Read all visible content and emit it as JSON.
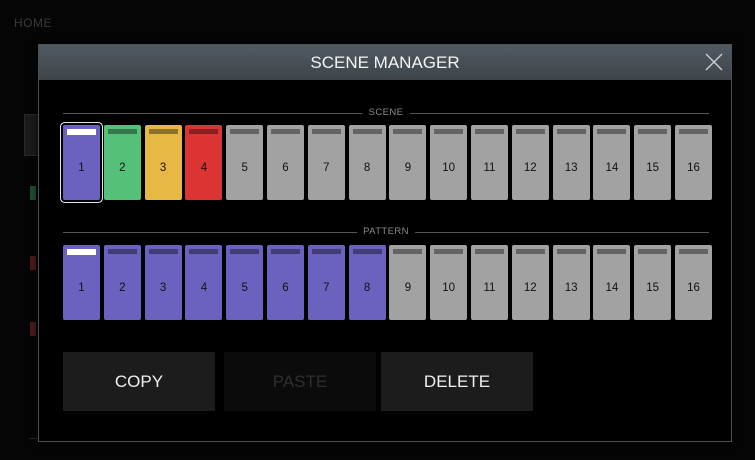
{
  "background": {
    "home_label": "HOME"
  },
  "modal": {
    "title": "SCENE MANAGER",
    "close_icon": "close-icon"
  },
  "scene": {
    "label": "SCENE",
    "selected": 1,
    "pads": [
      {
        "label": "1",
        "color": "#6b62bf",
        "selected": true
      },
      {
        "label": "2",
        "color": "#55c078"
      },
      {
        "label": "3",
        "color": "#e7b844"
      },
      {
        "label": "4",
        "color": "#dc3432"
      },
      {
        "label": "5",
        "color": "#a2a2a2"
      },
      {
        "label": "6",
        "color": "#a2a2a2"
      },
      {
        "label": "7",
        "color": "#a2a2a2"
      },
      {
        "label": "8",
        "color": "#a2a2a2"
      },
      {
        "label": "9",
        "color": "#a2a2a2"
      },
      {
        "label": "10",
        "color": "#a2a2a2"
      },
      {
        "label": "11",
        "color": "#a2a2a2"
      },
      {
        "label": "12",
        "color": "#a2a2a2"
      },
      {
        "label": "13",
        "color": "#a2a2a2"
      },
      {
        "label": "14",
        "color": "#a2a2a2"
      },
      {
        "label": "15",
        "color": "#a2a2a2"
      },
      {
        "label": "16",
        "color": "#a2a2a2"
      }
    ]
  },
  "pattern": {
    "label": "PATTERN",
    "pads": [
      {
        "label": "1",
        "color": "#6b62bf",
        "selected": true
      },
      {
        "label": "2",
        "color": "#6b62bf"
      },
      {
        "label": "3",
        "color": "#6b62bf"
      },
      {
        "label": "4",
        "color": "#6b62bf"
      },
      {
        "label": "5",
        "color": "#6b62bf"
      },
      {
        "label": "6",
        "color": "#6b62bf"
      },
      {
        "label": "7",
        "color": "#6b62bf"
      },
      {
        "label": "8",
        "color": "#6b62bf"
      },
      {
        "label": "9",
        "color": "#a2a2a2"
      },
      {
        "label": "10",
        "color": "#a2a2a2"
      },
      {
        "label": "11",
        "color": "#a2a2a2"
      },
      {
        "label": "12",
        "color": "#a2a2a2"
      },
      {
        "label": "13",
        "color": "#a2a2a2"
      },
      {
        "label": "14",
        "color": "#a2a2a2"
      },
      {
        "label": "15",
        "color": "#a2a2a2"
      },
      {
        "label": "16",
        "color": "#a2a2a2"
      }
    ]
  },
  "actions": {
    "copy": "COPY",
    "paste": "PASTE",
    "paste_enabled": false,
    "delete": "DELETE"
  }
}
